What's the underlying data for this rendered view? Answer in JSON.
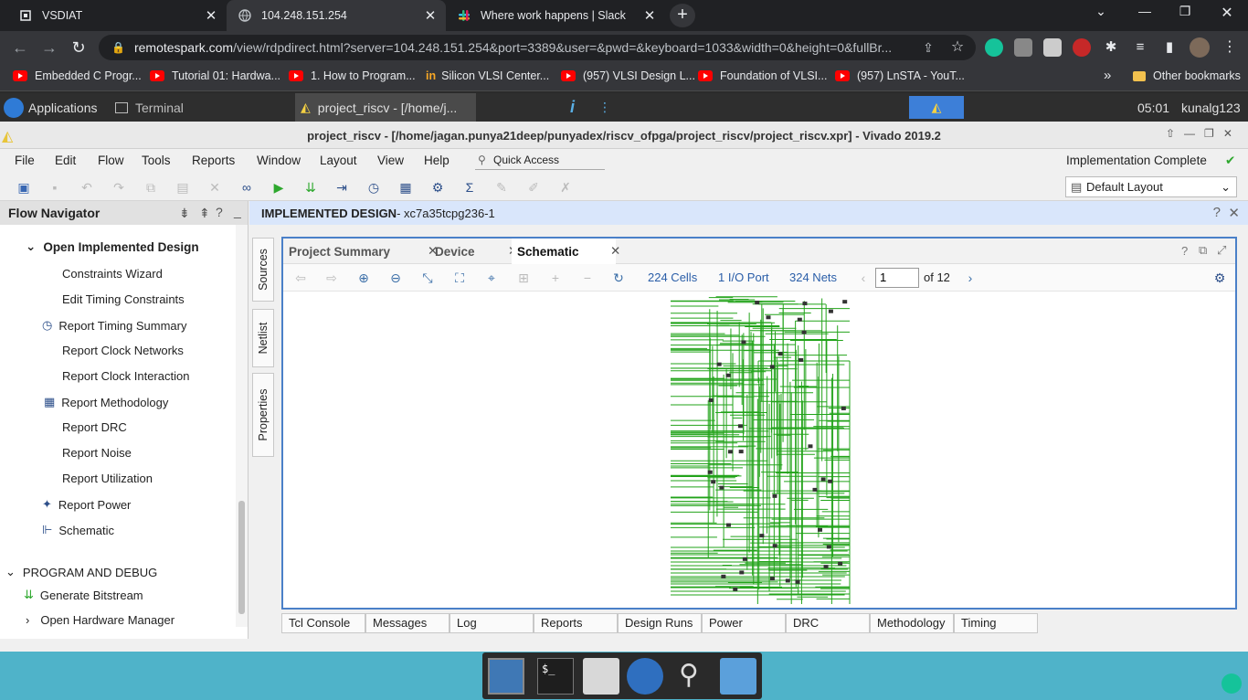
{
  "browser": {
    "tabs": [
      {
        "title": "VSDIAT",
        "active": false
      },
      {
        "title": "104.248.151.254",
        "active": true
      },
      {
        "title": "Where work happens | Slack",
        "active": false
      }
    ],
    "url_domain": "remotespark.com",
    "url_rest": "/view/rdpdirect.html?server=104.248.151.254&port=3389&user=&pwd=&keyboard=1033&width=0&height=0&fullBr...",
    "bookmarks": [
      "Embedded C Progr...",
      "Tutorial 01: Hardwa...",
      "1. How to Program...",
      "Silicon VLSI Center...",
      "(957) VLSI Design L...",
      "Foundation of VLSI...",
      "(957) LnSTA - YouT..."
    ],
    "other_bookmarks": "Other bookmarks",
    "more_chevron": "»"
  },
  "xfce": {
    "applications": "Applications",
    "terminal": "Terminal",
    "task": "project_riscv - [/home/j...",
    "time": "05:01",
    "user": "kunalg123"
  },
  "vivado": {
    "title": "project_riscv - [/home/jagan.punya21deep/punyadex/riscv_ofpga/project_riscv/project_riscv.xpr] - Vivado 2019.2",
    "menu": [
      "File",
      "Edit",
      "Flow",
      "Tools",
      "Reports",
      "Window",
      "Layout",
      "View",
      "Help"
    ],
    "quick_access": "Quick Access",
    "status": "Implementation Complete",
    "layout": "Default Layout"
  },
  "flow_navigator": {
    "header": "Flow Navigator",
    "open_impl": "Open Implemented Design",
    "items": [
      "Constraints Wizard",
      "Edit Timing Constraints",
      "Report Timing Summary",
      "Report Clock Networks",
      "Report Clock Interaction",
      "Report Methodology",
      "Report DRC",
      "Report Noise",
      "Report Utilization",
      "Report Power",
      "Schematic"
    ],
    "program_debug": "PROGRAM AND DEBUG",
    "generate_bitstream": "Generate Bitstream",
    "open_hw": "Open Hardware Manager"
  },
  "side_tabs": [
    "Sources",
    "Netlist",
    "Properties"
  ],
  "design_header": {
    "label": "IMPLEMENTED DESIGN",
    "part": " - xc7a35tcpg236-1"
  },
  "schematic": {
    "tabs": [
      "Project Summary",
      "Device",
      "Schematic"
    ],
    "cells": "224 Cells",
    "ports": "1 I/O Port",
    "nets": "324 Nets",
    "page": "1",
    "of_pages": "of 12"
  },
  "bottom_tabs": [
    "Tcl Console",
    "Messages",
    "Log",
    "Reports",
    "Design Runs",
    "Power",
    "DRC",
    "Methodology",
    "Timing"
  ],
  "colors": {
    "schematic_wire": "#22a31a",
    "accent_blue": "#4a80c8",
    "desktop": "#4fb3c9"
  }
}
